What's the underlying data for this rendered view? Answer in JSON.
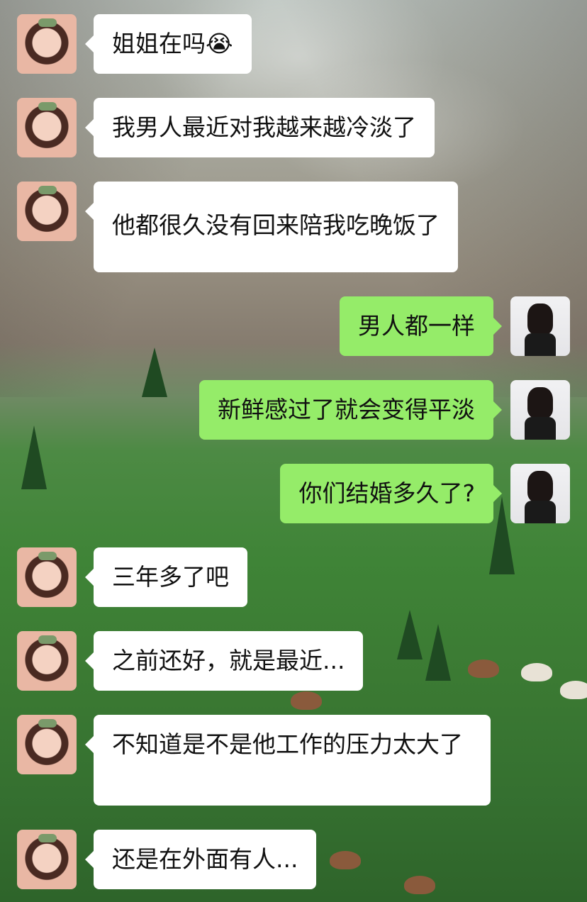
{
  "chat": {
    "messages": [
      {
        "sender": "other",
        "text": "姐姐在吗😭"
      },
      {
        "sender": "other",
        "text": "我男人最近对我越来越冷淡了"
      },
      {
        "sender": "other",
        "text": "他都很久没有回来陪我吃晚饭了"
      },
      {
        "sender": "self",
        "text": "男人都一样"
      },
      {
        "sender": "self",
        "text": "新鲜感过了就会变得平淡"
      },
      {
        "sender": "self",
        "text": "你们结婚多久了?"
      },
      {
        "sender": "other",
        "text": "三年多了吧"
      },
      {
        "sender": "other",
        "text": "之前还好，就是最近..."
      },
      {
        "sender": "other",
        "text": "不知道是不是他工作的压力太大了"
      },
      {
        "sender": "other",
        "text": "还是在外面有人..."
      }
    ]
  },
  "colors": {
    "self_bubble": "#95ec69",
    "other_bubble": "#ffffff",
    "text": "#111111"
  }
}
